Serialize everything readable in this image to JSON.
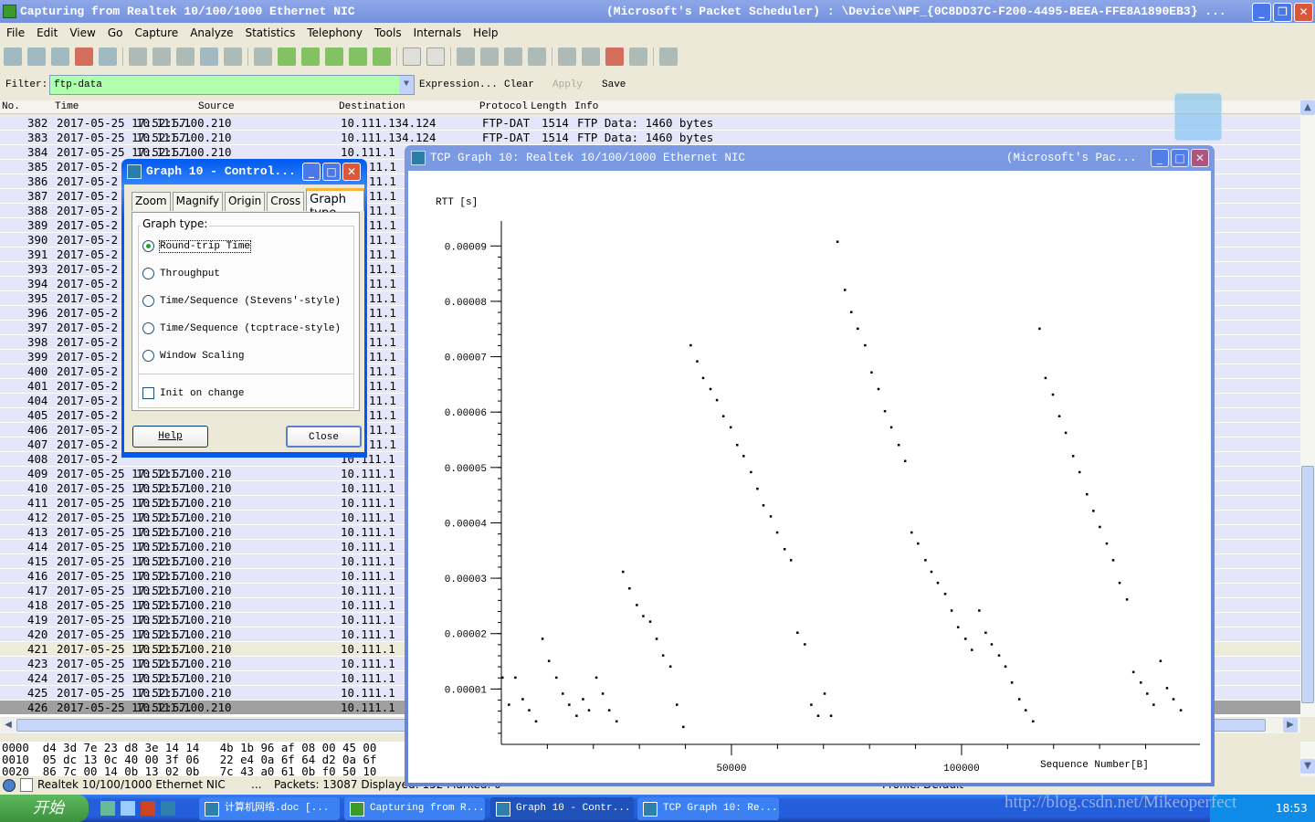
{
  "window": {
    "title": "Capturing from Realtek 10/100/1000 Ethernet NIC",
    "title_right": "(Microsoft's Packet Scheduler) : \\Device\\NPF_{0C8DD37C-F200-4495-BEEA-FFE8A1890EB3}  ..."
  },
  "menu": [
    "File",
    "Edit",
    "View",
    "Go",
    "Capture",
    "Analyze",
    "Statistics",
    "Telephony",
    "Tools",
    "Internals",
    "Help"
  ],
  "toolbar_icons": [
    "interface-list-icon",
    "capture-options-icon",
    "start-capture-icon",
    "stop-capture-icon",
    "restart-capture-icon",
    "open-file-icon",
    "save-file-icon",
    "close-file-icon",
    "reload-icon",
    "print-icon",
    "find-icon",
    "back-icon",
    "forward-icon",
    "go-to-packet-icon",
    "first-packet-icon",
    "last-packet-icon",
    "colorize-icon",
    "auto-scroll-icon",
    "zoom-in-icon",
    "zoom-out-icon",
    "normal-size-icon",
    "resize-columns-icon",
    "capture-filters-icon",
    "display-filters-icon",
    "coloring-rules-icon",
    "preferences-icon",
    "help-icon"
  ],
  "filter": {
    "label": "Filter:",
    "value": "ftp-data",
    "expression": "Expression...",
    "clear": "Clear",
    "apply": "Apply",
    "save": "Save"
  },
  "columns": [
    "No.",
    "Time",
    "Source",
    "Destination",
    "Protocol",
    "Length",
    "Info"
  ],
  "packets": [
    {
      "no": "382",
      "time": "2017-05-25 17:52:57.",
      "src": "10.111.100.210",
      "dst": "10.111.134.124",
      "proto": "FTP-DAT",
      "len": "1514",
      "info": "FTP Data: 1460 bytes"
    },
    {
      "no": "383",
      "time": "2017-05-25 17:52:57.",
      "src": "10.111.100.210",
      "dst": "10.111.134.124",
      "proto": "FTP-DAT",
      "len": "1514",
      "info": "FTP Data: 1460 bytes"
    },
    {
      "no": "384",
      "time": "2017-05-25 17:52:57.",
      "src": "10.111.100.210",
      "dst": "10.111.1"
    },
    {
      "no": "385",
      "time": "2017-05-2",
      "dst": "11.1"
    },
    {
      "no": "386",
      "time": "2017-05-2",
      "dst": "11.1"
    },
    {
      "no": "387",
      "time": "2017-05-2",
      "dst": "11.1"
    },
    {
      "no": "388",
      "time": "2017-05-2",
      "dst": "11.1"
    },
    {
      "no": "389",
      "time": "2017-05-2",
      "dst": "11.1"
    },
    {
      "no": "390",
      "time": "2017-05-2",
      "dst": "11.1"
    },
    {
      "no": "391",
      "time": "2017-05-2",
      "dst": "11.1"
    },
    {
      "no": "393",
      "time": "2017-05-2",
      "dst": "11.1"
    },
    {
      "no": "394",
      "time": "2017-05-2",
      "dst": "11.1"
    },
    {
      "no": "395",
      "time": "2017-05-2",
      "dst": "11.1"
    },
    {
      "no": "396",
      "time": "2017-05-2",
      "dst": "11.1"
    },
    {
      "no": "397",
      "time": "2017-05-2",
      "dst": "11.1"
    },
    {
      "no": "398",
      "time": "2017-05-2",
      "dst": "11.1"
    },
    {
      "no": "399",
      "time": "2017-05-2",
      "dst": "11.1"
    },
    {
      "no": "400",
      "time": "2017-05-2",
      "dst": "11.1"
    },
    {
      "no": "401",
      "time": "2017-05-2",
      "dst": "11.1"
    },
    {
      "no": "404",
      "time": "2017-05-2",
      "dst": "11.1"
    },
    {
      "no": "405",
      "time": "2017-05-2",
      "dst": "11.1"
    },
    {
      "no": "406",
      "time": "2017-05-2",
      "dst": "11.1"
    },
    {
      "no": "407",
      "time": "2017-05-2",
      "dst": "11.1"
    },
    {
      "no": "408",
      "time": "2017-05-2",
      "dst": "10.111.1"
    },
    {
      "no": "409",
      "time": "2017-05-25 17:52:57.",
      "src": "10.111.100.210",
      "dst": "10.111.1"
    },
    {
      "no": "410",
      "time": "2017-05-25 17:52:57.",
      "src": "10.111.100.210",
      "dst": "10.111.1"
    },
    {
      "no": "411",
      "time": "2017-05-25 17:52:57.",
      "src": "10.111.100.210",
      "dst": "10.111.1"
    },
    {
      "no": "412",
      "time": "2017-05-25 17:52:57.",
      "src": "10.111.100.210",
      "dst": "10.111.1"
    },
    {
      "no": "413",
      "time": "2017-05-25 17:52:57.",
      "src": "10.111.100.210",
      "dst": "10.111.1"
    },
    {
      "no": "414",
      "time": "2017-05-25 17:52:57.",
      "src": "10.111.100.210",
      "dst": "10.111.1"
    },
    {
      "no": "415",
      "time": "2017-05-25 17:52:57.",
      "src": "10.111.100.210",
      "dst": "10.111.1"
    },
    {
      "no": "416",
      "time": "2017-05-25 17:52:57.",
      "src": "10.111.100.210",
      "dst": "10.111.1"
    },
    {
      "no": "417",
      "time": "2017-05-25 17:52:57.",
      "src": "10.111.100.210",
      "dst": "10.111.1"
    },
    {
      "no": "418",
      "time": "2017-05-25 17:52:57.",
      "src": "10.111.100.210",
      "dst": "10.111.1"
    },
    {
      "no": "419",
      "time": "2017-05-25 17:52:57.",
      "src": "10.111.100.210",
      "dst": "10.111.1"
    },
    {
      "no": "420",
      "time": "2017-05-25 17:52:57.",
      "src": "10.111.100.210",
      "dst": "10.111.1"
    },
    {
      "no": "421",
      "time": "2017-05-25 17:52:57.",
      "src": "10.111.100.210",
      "dst": "10.111.1",
      "state": "marked"
    },
    {
      "no": "423",
      "time": "2017-05-25 17:52:57.",
      "src": "10.111.100.210",
      "dst": "10.111.1"
    },
    {
      "no": "424",
      "time": "2017-05-25 17:52:57.",
      "src": "10.111.100.210",
      "dst": "10.111.1"
    },
    {
      "no": "425",
      "time": "2017-05-25 17:52:57.",
      "src": "10.111.100.210",
      "dst": "10.111.1"
    },
    {
      "no": "426",
      "time": "2017-05-25 17:52:57.",
      "src": "10.111.100.210",
      "dst": "10.111.1",
      "state": "selected"
    }
  ],
  "hex": [
    "0000  d4 3d 7e 23 d8 3e 14 14   4b 1b 96 af 08 00 45 00",
    "0010  05 dc 13 0c 40 00 3f 06   22 e4 0a 6f 64 d2 0a 6f",
    "0020  86 7c 00 14 0b 13 02 0b   7c 43 a0 61 0b f0 50 10"
  ],
  "status": {
    "interface": "Realtek 10/100/1000 Ethernet NIC",
    "ellipsis": "...",
    "packets": "Packets: 13087 Displayed: 152 Marked: 0",
    "profile": "Profile: Default"
  },
  "control_dialog": {
    "title": "Graph 10 - Control...",
    "tabs": [
      "Zoom",
      "Magnify",
      "Origin",
      "Cross",
      "Graph type"
    ],
    "active_tab": "Graph type",
    "group_label": "Graph type:",
    "options": [
      "Round-trip Time",
      "Throughput",
      "Time/Sequence (Stevens'-style)",
      "Time/Sequence (tcptrace-style)",
      "Window Scaling"
    ],
    "selected_option": "Round-trip Time",
    "init_on_change": "Init on change",
    "init_checked": false,
    "help": "Help",
    "close": "Close"
  },
  "tcp_graph": {
    "title": "TCP Graph 10: Realtek 10/100/1000 Ethernet NIC",
    "title_right": "(Microsoft's Pac..."
  },
  "chart_data": {
    "type": "scatter",
    "title": "",
    "ylabel": "RTT [s]",
    "xlabel": "Sequence Number[B]",
    "xlim": [
      0,
      151800
    ],
    "ylim": [
      0,
      9.45e-05
    ],
    "xticks": [
      50000,
      100000
    ],
    "xtick_labels": [
      "50000",
      "100000"
    ],
    "yticks": [
      1e-05,
      2e-05,
      3e-05,
      4e-05,
      5e-05,
      6e-05,
      7e-05,
      8e-05,
      9e-05
    ],
    "ytick_labels": [
      "0.00001",
      "0.00002",
      "0.00003",
      "0.00004",
      "0.00005",
      "0.00006",
      "0.00007",
      "0.00008",
      "0.00009"
    ],
    "grid": false,
    "color": "#000000",
    "points": [
      [
        200,
        1.21e-05
      ],
      [
        1600,
        7.2e-06
      ],
      [
        3000,
        1.21e-05
      ],
      [
        4600,
        8.2e-06
      ],
      [
        6000,
        6.2e-06
      ],
      [
        7500,
        4.2e-06
      ],
      [
        8900,
        1.91e-05
      ],
      [
        10300,
        1.51e-05
      ],
      [
        11900,
        1.21e-05
      ],
      [
        13300,
        9.2e-06
      ],
      [
        14700,
        7.2e-06
      ],
      [
        16300,
        5.2e-06
      ],
      [
        17700,
        8.2e-06
      ],
      [
        19000,
        6.2e-06
      ],
      [
        20600,
        1.21e-05
      ],
      [
        22000,
        9.2e-06
      ],
      [
        23400,
        6.2e-06
      ],
      [
        25000,
        4.2e-06
      ],
      [
        26400,
        3.12e-05
      ],
      [
        27800,
        2.82e-05
      ],
      [
        29400,
        2.52e-05
      ],
      [
        30800,
        2.32e-05
      ],
      [
        32300,
        2.22e-05
      ],
      [
        33700,
        1.91e-05
      ],
      [
        35100,
        1.61e-05
      ],
      [
        36700,
        1.41e-05
      ],
      [
        38100,
        7.2e-06
      ],
      [
        39500,
        3.2e-06
      ],
      [
        41100,
        7.21e-05
      ],
      [
        42500,
        6.92e-05
      ],
      [
        43800,
        6.62e-05
      ],
      [
        45400,
        6.42e-05
      ],
      [
        46800,
        6.22e-05
      ],
      [
        48200,
        5.93e-05
      ],
      [
        49800,
        5.73e-05
      ],
      [
        51200,
        5.41e-05
      ],
      [
        52600,
        5.21e-05
      ],
      [
        54200,
        4.92e-05
      ],
      [
        55600,
        4.62e-05
      ],
      [
        56900,
        4.32e-05
      ],
      [
        58500,
        4.12e-05
      ],
      [
        59900,
        3.83e-05
      ],
      [
        61500,
        3.53e-05
      ],
      [
        62900,
        3.33e-05
      ],
      [
        64300,
        2.02e-05
      ],
      [
        65900,
        1.81e-05
      ],
      [
        67300,
        7.2e-06
      ],
      [
        68800,
        5.2e-06
      ],
      [
        70200,
        9.2e-06
      ],
      [
        71600,
        5.2e-06
      ],
      [
        73000,
        9.08e-05
      ],
      [
        74600,
        8.21e-05
      ],
      [
        76000,
        7.81e-05
      ],
      [
        77400,
        7.51e-05
      ],
      [
        79000,
        7.21e-05
      ],
      [
        80400,
        6.72e-05
      ],
      [
        81900,
        6.42e-05
      ],
      [
        83300,
        6.02e-05
      ],
      [
        84700,
        5.73e-05
      ],
      [
        86300,
        5.41e-05
      ],
      [
        87700,
        5.12e-05
      ],
      [
        89100,
        3.83e-05
      ],
      [
        90500,
        3.63e-05
      ],
      [
        92100,
        3.33e-05
      ],
      [
        93400,
        3.12e-05
      ],
      [
        94800,
        2.92e-05
      ],
      [
        96400,
        2.72e-05
      ],
      [
        97800,
        2.42e-05
      ],
      [
        99200,
        2.12e-05
      ],
      [
        100800,
        1.91e-05
      ],
      [
        102200,
        1.71e-05
      ],
      [
        103800,
        2.42e-05
      ],
      [
        105200,
        2.02e-05
      ],
      [
        106500,
        1.81e-05
      ],
      [
        108100,
        1.61e-05
      ],
      [
        109500,
        1.41e-05
      ],
      [
        110900,
        1.12e-05
      ],
      [
        112500,
        8.2e-06
      ],
      [
        113900,
        6.2e-06
      ],
      [
        115500,
        4.2e-06
      ],
      [
        116900,
        7.51e-05
      ],
      [
        118200,
        6.62e-05
      ],
      [
        119800,
        6.32e-05
      ],
      [
        121200,
        5.93e-05
      ],
      [
        122600,
        5.63e-05
      ],
      [
        124200,
        5.21e-05
      ],
      [
        125600,
        4.92e-05
      ],
      [
        127200,
        4.52e-05
      ],
      [
        128600,
        4.22e-05
      ],
      [
        130000,
        3.93e-05
      ],
      [
        131500,
        3.63e-05
      ],
      [
        132900,
        3.33e-05
      ],
      [
        134300,
        2.92e-05
      ],
      [
        135900,
        2.62e-05
      ],
      [
        137300,
        1.31e-05
      ],
      [
        138900,
        1.12e-05
      ],
      [
        140300,
        9.2e-06
      ],
      [
        141700,
        7.2e-06
      ],
      [
        143200,
        1.51e-05
      ],
      [
        144600,
        1.02e-05
      ],
      [
        146000,
        8.2e-06
      ],
      [
        147600,
        6.2e-06
      ]
    ]
  },
  "taskbar": {
    "start": "开始",
    "tasks": [
      "计算机网络.doc [...",
      "Capturing from R...",
      "Graph 10 - Contr...",
      "TCP Graph 10: Re..."
    ],
    "active_task": "Graph 10 - Contr...",
    "clock": "18:53",
    "watermark": "http://blog.csdn.net/Mikeoperfect"
  }
}
